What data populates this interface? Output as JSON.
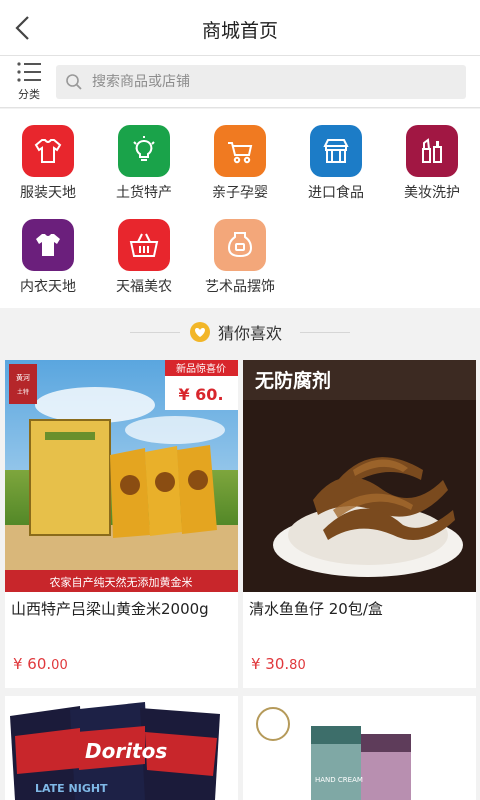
{
  "header": {
    "title": "商城首页"
  },
  "search": {
    "category_label": "分类",
    "placeholder": "搜索商品或店铺"
  },
  "categories": [
    {
      "label": "服装天地",
      "icon": "shirt-icon",
      "color": "#e8262d"
    },
    {
      "label": "土货特产",
      "icon": "lightbulb-icon",
      "color": "#1aa34a"
    },
    {
      "label": "亲子孕婴",
      "icon": "stroller-icon",
      "color": "#f07a21"
    },
    {
      "label": "进口食品",
      "icon": "store-icon",
      "color": "#1c7cc7"
    },
    {
      "label": "美妆洗护",
      "icon": "cosmetics-icon",
      "color": "#a11743"
    },
    {
      "label": "内衣天地",
      "icon": "tshirt-icon",
      "color": "#6b1f7c"
    },
    {
      "label": "天福美农",
      "icon": "basket-icon",
      "color": "#e8262d"
    },
    {
      "label": "艺术品摆饰",
      "icon": "vase-icon",
      "color": "#f3a77a"
    }
  ],
  "section": {
    "title": "猜你喜欢"
  },
  "products": [
    {
      "name": "山西特产吕梁山黄金米2000g",
      "price_main": "¥ 60.",
      "price_cents": "00",
      "badge_title": "新品惊喜价",
      "badge_price": "¥ 60.",
      "banner": "农家自产纯天然无添加黄金米",
      "brand": "黄河鳍 土特产品"
    },
    {
      "name": "清水鱼鱼仔 20包/盒",
      "price_main": "¥ 30.",
      "price_cents": "80",
      "headline": "无防腐剂"
    },
    {
      "name": "Doritos",
      "sub": "LATE NIGHT"
    },
    {
      "name": "HAND CREAM"
    }
  ]
}
